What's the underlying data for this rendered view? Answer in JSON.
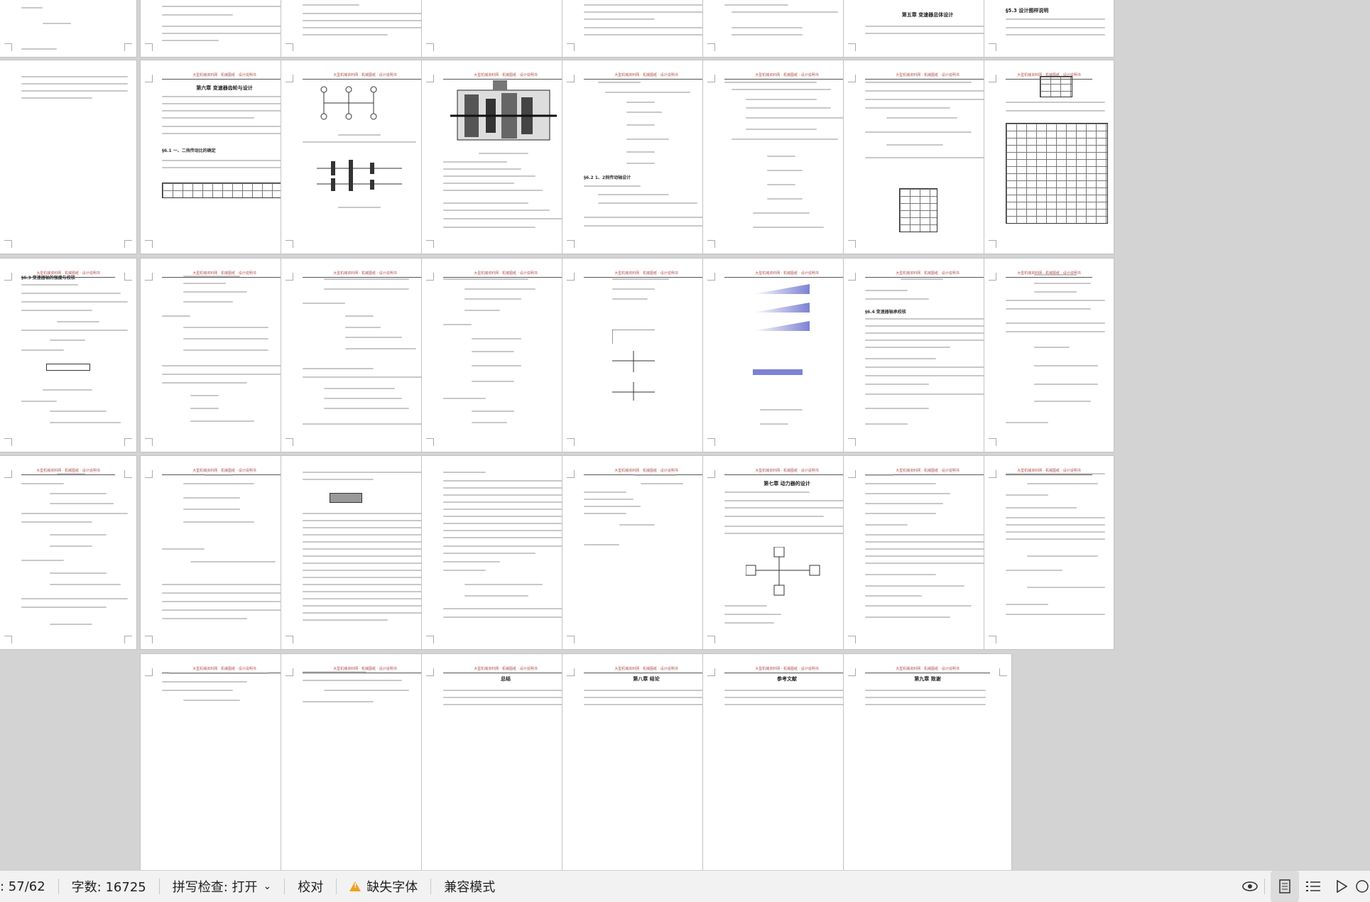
{
  "header_text": "大型机械资料网 · 机械图纸 · 设计说明书",
  "pages": {
    "chapter_reducer": "第六章 变速器齿轮与设计",
    "section_gear_ratio": "§6.1 一、二挡传动比的确定",
    "section_shaft": "§6.2 1、2挡传动轴设计",
    "section_check": "§6.3 变速器轴的强度与校核",
    "section_bearing": "§6.4 变速器轴承校核",
    "chapter_power": "第七章 动力器的设计",
    "chapter_conclusion": "第八章 结论",
    "section_acknowledge": "第九章 致谢",
    "section_ref": "参考文献",
    "section_summary": "总结",
    "section_final": "第五章 变速器总体设计",
    "section_design": "§5.3 设计图样说明"
  },
  "statusbar": {
    "page_indicator": ": 57/62",
    "word_count": "字数: 16725",
    "spell_check": "拼写检查: 打开",
    "spell_check_caret": "⌄",
    "proofread": "校对",
    "missing_fonts": "缺失字体",
    "compat_mode": "兼容模式"
  }
}
